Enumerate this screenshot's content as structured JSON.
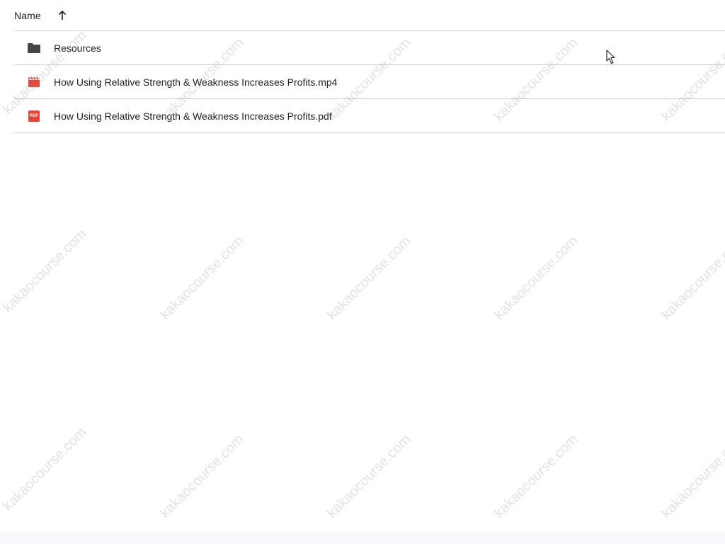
{
  "header": {
    "name_label": "Name",
    "sort_icon": "arrow-up-icon"
  },
  "rows": [
    {
      "label": "Resources",
      "icon": "folder-icon"
    },
    {
      "label": "How Using Relative Strength & Weakness Increases Profits.mp4",
      "icon": "video-file-icon"
    },
    {
      "label": "How Using Relative Strength & Weakness Increases Profits.pdf",
      "icon": "pdf-file-icon"
    }
  ],
  "pdf_badge_text": "PDF",
  "watermark_text": "kakaocourse.com",
  "colors": {
    "folder": "#444746",
    "video": "#ea4335",
    "pdf": "#ea4335",
    "divider": "#c7c7c7"
  }
}
